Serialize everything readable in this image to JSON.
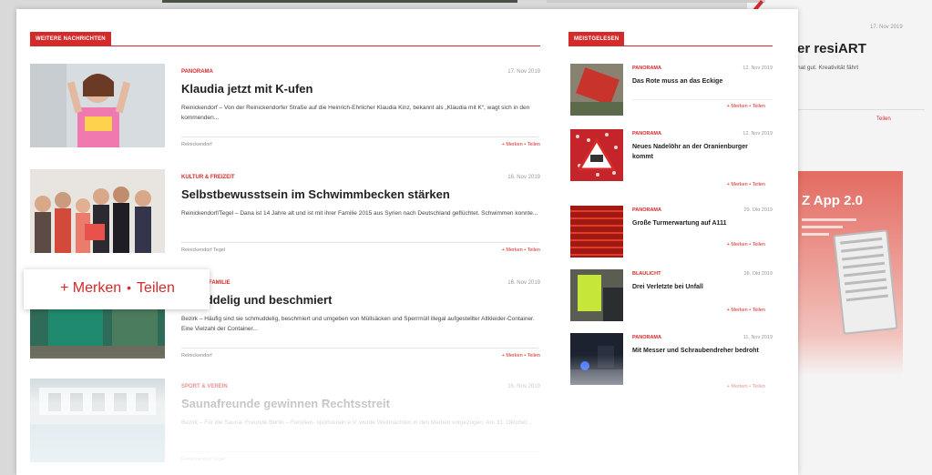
{
  "background_page": {
    "date": "17. Nov 2019",
    "title": "er resiART",
    "text": "hat gut. Kreativität fährt",
    "teilen": "Teilen",
    "app_title": "Z App 2.0"
  },
  "left_section": {
    "label": "WEITERE NACHRICHTEN"
  },
  "right_section": {
    "label": "MEISTGELESEN"
  },
  "articles": [
    {
      "category": "PANORAMA",
      "date": "17. Nov 2019",
      "title": "Klaudia jetzt mit K-ufen",
      "text": "Reinickendorf – Von der Reinickendorfer Straße auf die Heinrich-Ehrlicher Klaudia Kinz, bekannt als „Klaudia mit K“, wagt sich in den kommenden...",
      "tags": "Reinickendorf",
      "actions": "+ Merken • Teilen"
    },
    {
      "category": "KULTUR & FREIZEIT",
      "date": "16. Nov 2019",
      "title": "Selbstbewusstsein im Schwimmbecken stärken",
      "text": "Reinickendorf/Tegel – Dana ist 14 Jahre alt und ist mit ihrer Familie 2015 aus Syrien nach Deutschland geflüchtet. Schwimmen konnte...",
      "tags": "Reinickendorf  Tegel",
      "actions": "+ Merken • Teilen"
    },
    {
      "category": "BEZIRK & FAMILIE",
      "date": "16. Nov 2019",
      "title": "...huddelig und beschmiert",
      "text": "Bezirk – Häufig sind sie schmuddelig, beschmiert und umgeben von Müllsäcken und Sperrmüll illegal aufgestellter Altkleider-Container. Eine Vielzahl der Container...",
      "tags": "Reinickendorf",
      "actions": "+ Merken • Teilen"
    },
    {
      "category": "SPORT & VEREIN",
      "date": "16. Nov 2019",
      "title": "Saunafreunde gewinnen Rechtsstreit",
      "text": "Bezirk – Für die Sauna- Freunde Berlin – Familien- sportverein e.V. wurde Weihnachten in den Medien vorgezogen. Am 31. Oktober...",
      "tags": "Reinickendorf  Tegel",
      "actions": ""
    }
  ],
  "sidebar": [
    {
      "category": "PANORAMA",
      "date": "12. Nov 2019",
      "title": "Das Rote muss an das Eckige",
      "actions": "+ Merken • Teilen"
    },
    {
      "category": "PANORAMA",
      "date": "12. Nov 2019",
      "title": "Neues Nadelöhr an der Oranienburger kommt",
      "actions": "+ Merken • Teilen"
    },
    {
      "category": "PANORAMA",
      "date": "29. Okt 2019",
      "title": "Große Turmerwartung auf A111",
      "actions": "+ Merken • Teilen"
    },
    {
      "category": "BLAULICHT",
      "date": "28. Okt 2019",
      "title": "Drei Verletzte bei Unfall",
      "actions": "+ Merken • Teilen"
    },
    {
      "category": "PANORAMA",
      "date": "11. Nov 2019",
      "title": "Mit Messer und Schraubendreher bedroht",
      "actions": "+ Merken • Teilen"
    }
  ],
  "callout": {
    "merken": "+ Merken",
    "teilen": "Teilen"
  },
  "colors": {
    "accent": "#d42a2a"
  }
}
